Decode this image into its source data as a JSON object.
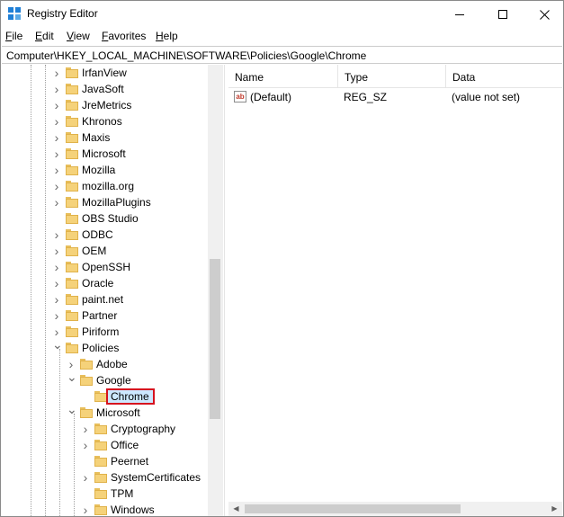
{
  "window": {
    "title": "Registry Editor"
  },
  "menu": [
    "File",
    "Edit",
    "View",
    "Favorites",
    "Help"
  ],
  "address": "Computer\\HKEY_LOCAL_MACHINE\\SOFTWARE\\Policies\\Google\\Chrome",
  "tree": [
    {
      "label": "IrfanView",
      "depth": 0,
      "expand": "collapsed"
    },
    {
      "label": "JavaSoft",
      "depth": 0,
      "expand": "collapsed"
    },
    {
      "label": "JreMetrics",
      "depth": 0,
      "expand": "collapsed"
    },
    {
      "label": "Khronos",
      "depth": 0,
      "expand": "collapsed"
    },
    {
      "label": "Maxis",
      "depth": 0,
      "expand": "collapsed"
    },
    {
      "label": "Microsoft",
      "depth": 0,
      "expand": "collapsed"
    },
    {
      "label": "Mozilla",
      "depth": 0,
      "expand": "collapsed"
    },
    {
      "label": "mozilla.org",
      "depth": 0,
      "expand": "collapsed"
    },
    {
      "label": "MozillaPlugins",
      "depth": 0,
      "expand": "collapsed"
    },
    {
      "label": "OBS Studio",
      "depth": 0,
      "expand": "none"
    },
    {
      "label": "ODBC",
      "depth": 0,
      "expand": "collapsed"
    },
    {
      "label": "OEM",
      "depth": 0,
      "expand": "collapsed"
    },
    {
      "label": "OpenSSH",
      "depth": 0,
      "expand": "collapsed"
    },
    {
      "label": "Oracle",
      "depth": 0,
      "expand": "collapsed"
    },
    {
      "label": "paint.net",
      "depth": 0,
      "expand": "collapsed"
    },
    {
      "label": "Partner",
      "depth": 0,
      "expand": "collapsed"
    },
    {
      "label": "Piriform",
      "depth": 0,
      "expand": "collapsed"
    },
    {
      "label": "Policies",
      "depth": 0,
      "expand": "expanded"
    },
    {
      "label": "Adobe",
      "depth": 1,
      "expand": "collapsed"
    },
    {
      "label": "Google",
      "depth": 1,
      "expand": "expanded"
    },
    {
      "label": "Chrome",
      "depth": 2,
      "expand": "none",
      "selected": true
    },
    {
      "label": "Microsoft",
      "depth": 1,
      "expand": "expanded"
    },
    {
      "label": "Cryptography",
      "depth": 2,
      "expand": "collapsed"
    },
    {
      "label": "Office",
      "depth": 2,
      "expand": "collapsed"
    },
    {
      "label": "Peernet",
      "depth": 2,
      "expand": "none"
    },
    {
      "label": "SystemCertificates",
      "depth": 2,
      "expand": "collapsed"
    },
    {
      "label": "TPM",
      "depth": 2,
      "expand": "none"
    },
    {
      "label": "Windows",
      "depth": 2,
      "expand": "collapsed"
    }
  ],
  "list": {
    "columns": [
      "Name",
      "Type",
      "Data"
    ],
    "rows": [
      {
        "icon": "string-value-icon",
        "icon_text": "ab",
        "name": "(Default)",
        "type": "REG_SZ",
        "data": "(value not set)"
      }
    ]
  },
  "colors": {
    "selection_bg": "#cce8ff",
    "highlight_border": "#d6121f",
    "folder": "#f5d27a"
  }
}
